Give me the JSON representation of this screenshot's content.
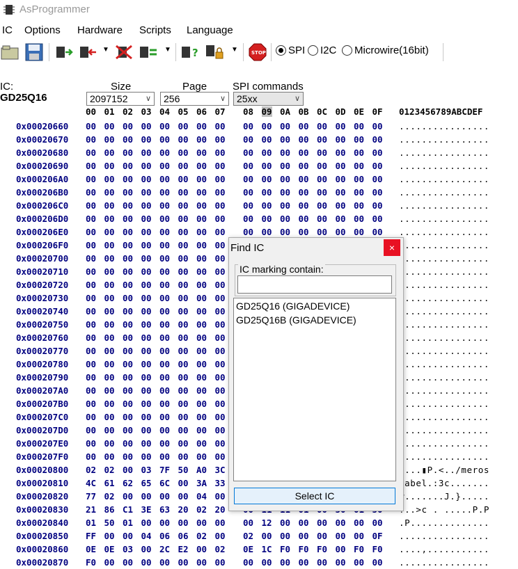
{
  "window": {
    "title": "AsProgrammer"
  },
  "menu": [
    "IC",
    "Options",
    "Hardware",
    "Scripts",
    "Language"
  ],
  "toolbar": {
    "radios": [
      {
        "label": "SPI",
        "checked": true
      },
      {
        "label": "I2C",
        "checked": false
      },
      {
        "label": "Microwire(16bit)",
        "checked": false
      }
    ]
  },
  "ic_info": {
    "ic_label": "IC:",
    "ic_name": "GD25Q16",
    "size_label": "Size",
    "size_value": "2097152",
    "page_label": "Page",
    "page_value": "256",
    "spi_label": "SPI commands",
    "spi_value": "25xx"
  },
  "hex": {
    "col_headers": [
      "00",
      "01",
      "02",
      "03",
      "04",
      "05",
      "06",
      "07",
      "08",
      "09",
      "0A",
      "0B",
      "0C",
      "0D",
      "0E",
      "0F"
    ],
    "ascii_header": "0123456789ABCDEF",
    "rows": [
      {
        "addr": "0x00020660",
        "bytes": [
          "00",
          "00",
          "00",
          "00",
          "00",
          "00",
          "00",
          "00",
          "00",
          "00",
          "00",
          "00",
          "00",
          "00",
          "00",
          "00"
        ],
        "ascii": "................"
      },
      {
        "addr": "0x00020670",
        "bytes": [
          "00",
          "00",
          "00",
          "00",
          "00",
          "00",
          "00",
          "00",
          "00",
          "00",
          "00",
          "00",
          "00",
          "00",
          "00",
          "00"
        ],
        "ascii": "................"
      },
      {
        "addr": "0x00020680",
        "bytes": [
          "00",
          "00",
          "00",
          "00",
          "00",
          "00",
          "00",
          "00",
          "00",
          "00",
          "00",
          "00",
          "00",
          "00",
          "00",
          "00"
        ],
        "ascii": "................"
      },
      {
        "addr": "0x00020690",
        "bytes": [
          "00",
          "00",
          "00",
          "00",
          "00",
          "00",
          "00",
          "00",
          "00",
          "00",
          "00",
          "00",
          "00",
          "00",
          "00",
          "00"
        ],
        "ascii": "................"
      },
      {
        "addr": "0x000206A0",
        "bytes": [
          "00",
          "00",
          "00",
          "00",
          "00",
          "00",
          "00",
          "00",
          "00",
          "00",
          "00",
          "00",
          "00",
          "00",
          "00",
          "00"
        ],
        "ascii": "................"
      },
      {
        "addr": "0x000206B0",
        "bytes": [
          "00",
          "00",
          "00",
          "00",
          "00",
          "00",
          "00",
          "00",
          "00",
          "00",
          "00",
          "00",
          "00",
          "00",
          "00",
          "00"
        ],
        "ascii": "................"
      },
      {
        "addr": "0x000206C0",
        "bytes": [
          "00",
          "00",
          "00",
          "00",
          "00",
          "00",
          "00",
          "00",
          "00",
          "00",
          "00",
          "00",
          "00",
          "00",
          "00",
          "00"
        ],
        "ascii": "................"
      },
      {
        "addr": "0x000206D0",
        "bytes": [
          "00",
          "00",
          "00",
          "00",
          "00",
          "00",
          "00",
          "00",
          "00",
          "00",
          "00",
          "00",
          "00",
          "00",
          "00",
          "00"
        ],
        "ascii": "................"
      },
      {
        "addr": "0x000206E0",
        "bytes": [
          "00",
          "00",
          "00",
          "00",
          "00",
          "00",
          "00",
          "00",
          "00",
          "00",
          "00",
          "00",
          "00",
          "00",
          "00",
          "00"
        ],
        "ascii": "................"
      },
      {
        "addr": "0x000206F0",
        "bytes": [
          "00",
          "00",
          "00",
          "00",
          "00",
          "00",
          "00",
          "00",
          "",
          "",
          "",
          "",
          "",
          "",
          "",
          ""
        ],
        "ascii": "................"
      },
      {
        "addr": "0x00020700",
        "bytes": [
          "00",
          "00",
          "00",
          "00",
          "00",
          "00",
          "00",
          "00",
          "",
          "",
          "",
          "",
          "",
          "",
          "",
          ""
        ],
        "ascii": "................"
      },
      {
        "addr": "0x00020710",
        "bytes": [
          "00",
          "00",
          "00",
          "00",
          "00",
          "00",
          "00",
          "00",
          "",
          "",
          "",
          "",
          "",
          "",
          "",
          ""
        ],
        "ascii": "................"
      },
      {
        "addr": "0x00020720",
        "bytes": [
          "00",
          "00",
          "00",
          "00",
          "00",
          "00",
          "00",
          "00",
          "",
          "",
          "",
          "",
          "",
          "",
          "",
          ""
        ],
        "ascii": "................"
      },
      {
        "addr": "0x00020730",
        "bytes": [
          "00",
          "00",
          "00",
          "00",
          "00",
          "00",
          "00",
          "00",
          "",
          "",
          "",
          "",
          "",
          "",
          "",
          ""
        ],
        "ascii": "................"
      },
      {
        "addr": "0x00020740",
        "bytes": [
          "00",
          "00",
          "00",
          "00",
          "00",
          "00",
          "00",
          "00",
          "",
          "",
          "",
          "",
          "",
          "",
          "",
          ""
        ],
        "ascii": "................"
      },
      {
        "addr": "0x00020750",
        "bytes": [
          "00",
          "00",
          "00",
          "00",
          "00",
          "00",
          "00",
          "00",
          "",
          "",
          "",
          "",
          "",
          "",
          "",
          ""
        ],
        "ascii": "................"
      },
      {
        "addr": "0x00020760",
        "bytes": [
          "00",
          "00",
          "00",
          "00",
          "00",
          "00",
          "00",
          "00",
          "",
          "",
          "",
          "",
          "",
          "",
          "",
          ""
        ],
        "ascii": "................"
      },
      {
        "addr": "0x00020770",
        "bytes": [
          "00",
          "00",
          "00",
          "00",
          "00",
          "00",
          "00",
          "00",
          "",
          "",
          "",
          "",
          "",
          "",
          "",
          ""
        ],
        "ascii": "................"
      },
      {
        "addr": "0x00020780",
        "bytes": [
          "00",
          "00",
          "00",
          "00",
          "00",
          "00",
          "00",
          "00",
          "",
          "",
          "",
          "",
          "",
          "",
          "",
          ""
        ],
        "ascii": "................"
      },
      {
        "addr": "0x00020790",
        "bytes": [
          "00",
          "00",
          "00",
          "00",
          "00",
          "00",
          "00",
          "00",
          "",
          "",
          "",
          "",
          "",
          "",
          "",
          ""
        ],
        "ascii": "................"
      },
      {
        "addr": "0x000207A0",
        "bytes": [
          "00",
          "00",
          "00",
          "00",
          "00",
          "00",
          "00",
          "00",
          "",
          "",
          "",
          "",
          "",
          "",
          "",
          ""
        ],
        "ascii": "................"
      },
      {
        "addr": "0x000207B0",
        "bytes": [
          "00",
          "00",
          "00",
          "00",
          "00",
          "00",
          "00",
          "00",
          "",
          "",
          "",
          "",
          "",
          "",
          "",
          ""
        ],
        "ascii": "................"
      },
      {
        "addr": "0x000207C0",
        "bytes": [
          "00",
          "00",
          "00",
          "00",
          "00",
          "00",
          "00",
          "00",
          "",
          "",
          "",
          "",
          "",
          "",
          "",
          ""
        ],
        "ascii": "................"
      },
      {
        "addr": "0x000207D0",
        "bytes": [
          "00",
          "00",
          "00",
          "00",
          "00",
          "00",
          "00",
          "00",
          "",
          "",
          "",
          "",
          "",
          "",
          "",
          ""
        ],
        "ascii": "................"
      },
      {
        "addr": "0x000207E0",
        "bytes": [
          "00",
          "00",
          "00",
          "00",
          "00",
          "00",
          "00",
          "00",
          "",
          "",
          "",
          "",
          "",
          "",
          "",
          ""
        ],
        "ascii": "................"
      },
      {
        "addr": "0x000207F0",
        "bytes": [
          "00",
          "00",
          "00",
          "00",
          "00",
          "00",
          "00",
          "00",
          "",
          "",
          "",
          "",
          "",
          "",
          "",
          ""
        ],
        "ascii": "................"
      },
      {
        "addr": "0x00020800",
        "bytes": [
          "02",
          "02",
          "00",
          "03",
          "7F",
          "50",
          "A0",
          "3C",
          "",
          "",
          "",
          "",
          "",
          "",
          "",
          ""
        ],
        "ascii": "....▮P.<../meros"
      },
      {
        "addr": "0x00020810",
        "bytes": [
          "4C",
          "61",
          "62",
          "65",
          "6C",
          "00",
          "3A",
          "33",
          "",
          "",
          "",
          "",
          "",
          "",
          "",
          ""
        ],
        "ascii": "Label.:3c......."
      },
      {
        "addr": "0x00020820",
        "bytes": [
          "77",
          "02",
          "00",
          "00",
          "00",
          "00",
          "04",
          "00",
          "",
          "",
          "",
          "",
          "",
          "",
          "",
          ""
        ],
        "ascii": "w.......J.}....."
      },
      {
        "addr": "0x00020830",
        "bytes": [
          "21",
          "86",
          "C1",
          "3E",
          "63",
          "20",
          "02",
          "20",
          "00",
          "11",
          "11",
          "01",
          "00",
          "50",
          "01",
          "50"
        ],
        "ascii": "!..>c . .....P.P"
      },
      {
        "addr": "0x00020840",
        "bytes": [
          "01",
          "50",
          "01",
          "00",
          "00",
          "00",
          "00",
          "00",
          "00",
          "12",
          "00",
          "00",
          "00",
          "00",
          "00",
          "00"
        ],
        "ascii": ".P.............."
      },
      {
        "addr": "0x00020850",
        "bytes": [
          "FF",
          "00",
          "00",
          "04",
          "06",
          "06",
          "02",
          "00",
          "02",
          "00",
          "00",
          "00",
          "00",
          "00",
          "00",
          "0F"
        ],
        "ascii": "................"
      },
      {
        "addr": "0x00020860",
        "bytes": [
          "0E",
          "0E",
          "03",
          "00",
          "2C",
          "E2",
          "00",
          "02",
          "0E",
          "1C",
          "F0",
          "F0",
          "F0",
          "00",
          "F0",
          "F0"
        ],
        "ascii": "....,..........."
      },
      {
        "addr": "0x00020870",
        "bytes": [
          "F0",
          "00",
          "00",
          "00",
          "00",
          "00",
          "00",
          "00",
          "00",
          "00",
          "00",
          "00",
          "00",
          "00",
          "00",
          "00"
        ],
        "ascii": "................"
      }
    ]
  },
  "find_ic_dialog": {
    "title": "Find IC",
    "close": "×",
    "group_label": "IC marking contain:",
    "input_value": "",
    "results": [
      "GD25Q16 (GIGADEVICE)",
      "GD25Q16B (GIGADEVICE)"
    ],
    "select_button": "Select IC"
  }
}
